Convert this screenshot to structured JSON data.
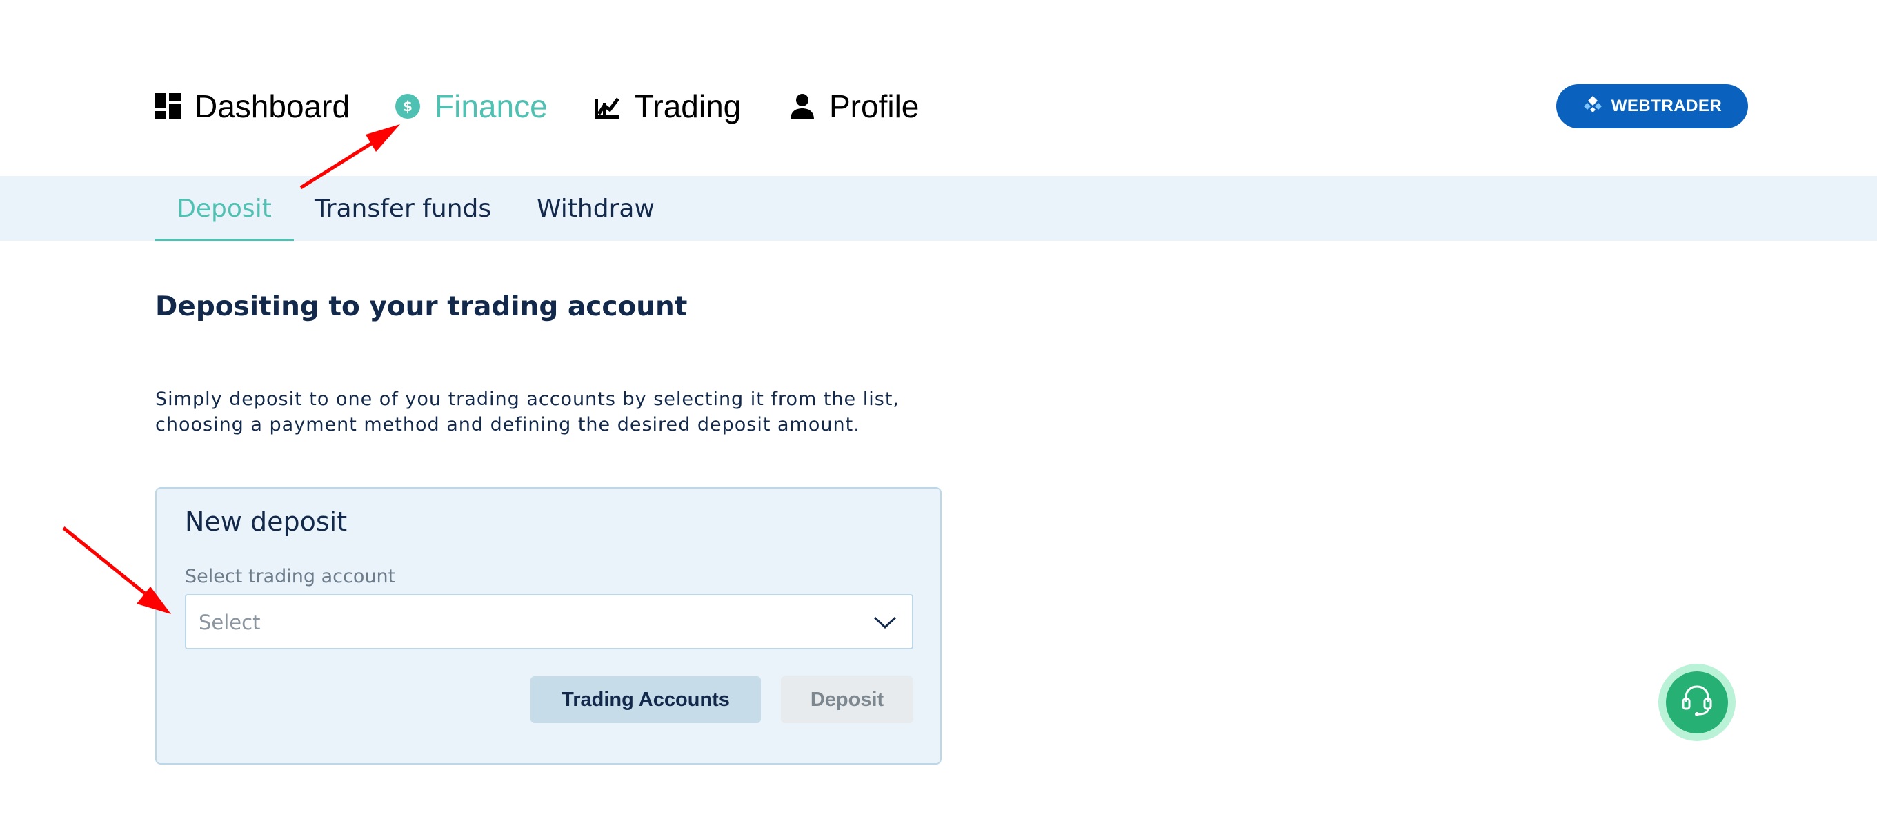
{
  "nav": {
    "items": [
      {
        "label": "Dashboard",
        "icon": "dashboard-icon",
        "active": false
      },
      {
        "label": "Finance",
        "icon": "dollar-circle-icon",
        "active": true
      },
      {
        "label": "Trading",
        "icon": "chart-icon",
        "active": false
      },
      {
        "label": "Profile",
        "icon": "person-icon",
        "active": false
      }
    ],
    "webtrader_label": "WEBTRADER"
  },
  "subnav": {
    "tabs": [
      {
        "label": "Deposit",
        "active": true
      },
      {
        "label": "Transfer funds",
        "active": false
      },
      {
        "label": "Withdraw",
        "active": false
      }
    ]
  },
  "main": {
    "title": "Depositing to your trading account",
    "intro_line1": "Simply deposit to one of you trading accounts by selecting it from the list,",
    "intro_line2": "choosing a payment method and defining the desired deposit amount."
  },
  "card": {
    "title": "New deposit",
    "field_label": "Select trading account",
    "select_placeholder": "Select",
    "accounts_button": "Trading Accounts",
    "deposit_button": "Deposit"
  },
  "support": {
    "icon": "headset-icon"
  },
  "colors": {
    "accent": "#4fc1b3",
    "brand_blue": "#0a62be",
    "panel_bg": "#eaf3f9",
    "support_green": "#26b074",
    "annotation_red": "#ff0000"
  }
}
